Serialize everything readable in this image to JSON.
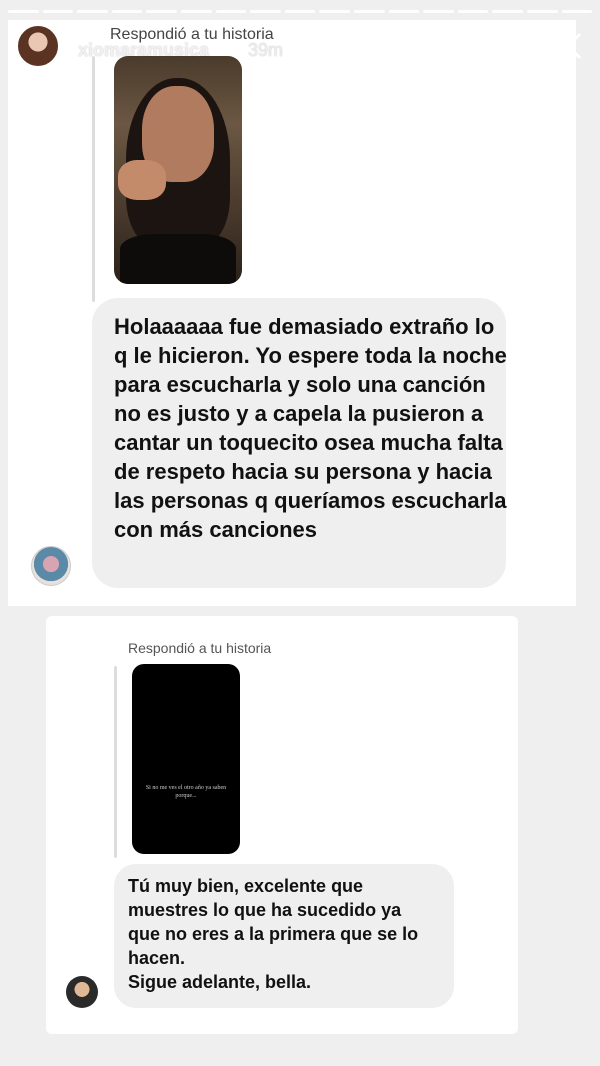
{
  "story": {
    "progress_segments": 17,
    "username": "xiomaramusica",
    "time_ago": "39m",
    "more_icon": "ellipsis-icon",
    "close_icon": "close-icon"
  },
  "message_1": {
    "reply_label": "Respondió a tu historia",
    "text": "Holaaaaaa fue demasiado extraño lo q le hicieron.  Yo espere toda la noche para escucharla y solo una canción no es justo y a capela la pusieron a cantar un toquecito osea mucha falta de respeto hacia su persona y hacia las personas q queríamos escucharla con más canciones"
  },
  "message_2": {
    "reply_label": "Respondió a tu historia",
    "story_thumbnail_text": "Si no me ves el otro año ya saben porque...",
    "text_lines": [
      "Tú muy bien, excelente que",
      "muestres lo que ha sucedido ya",
      "que no eres a la primera que se lo",
      "hacen.",
      "Sigue adelante, bella."
    ]
  },
  "colors": {
    "background": "#efefef",
    "card": "#ffffff",
    "bubble": "#efefef",
    "text": "#111111"
  }
}
